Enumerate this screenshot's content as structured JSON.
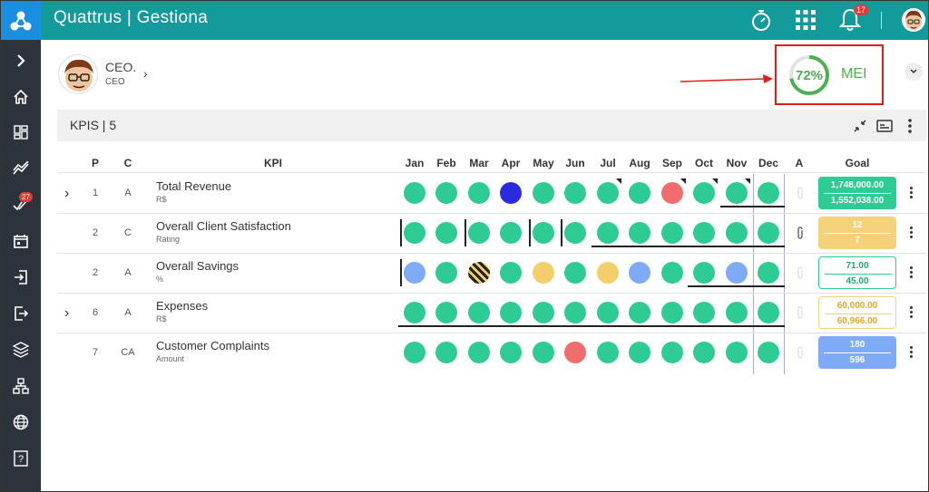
{
  "app": {
    "title": "Quattrus | Gestiona",
    "notifications": "17"
  },
  "sidebar": {
    "tasks_badge": "27"
  },
  "profile": {
    "name": "CEO.",
    "role": "CEO"
  },
  "mei": {
    "percent_text": "72%",
    "percent": 72,
    "label": "MEI"
  },
  "kpis": {
    "title": "KPIS | 5"
  },
  "table": {
    "headers": {
      "p": "P",
      "c": "C",
      "kpi": "KPI",
      "a": "A",
      "goal": "Goal"
    },
    "months": [
      "Jan",
      "Feb",
      "Mar",
      "Apr",
      "May",
      "Jun",
      "Jul",
      "Aug",
      "Sep",
      "Oct",
      "Nov",
      "Dec"
    ],
    "rows": [
      {
        "p": "1",
        "c": "A",
        "name": "Total Revenue",
        "unit": "R$",
        "goal_top": "1,748,000.00",
        "goal_bottom": "1,552,038.00"
      },
      {
        "p": "2",
        "c": "C",
        "name": "Overall Client Satisfaction",
        "unit": "Rating",
        "goal_top": "12",
        "goal_bottom": "7"
      },
      {
        "p": "2",
        "c": "A",
        "name": "Overall Savings",
        "unit": "%",
        "goal_top": "71.00",
        "goal_bottom": "45.00"
      },
      {
        "p": "6",
        "c": "A",
        "name": "Expenses",
        "unit": "R$",
        "goal_top": "60,000.00",
        "goal_bottom": "60,966.00"
      },
      {
        "p": "7",
        "c": "CA",
        "name": "Customer Complaints",
        "unit": "Amount",
        "goal_top": "180",
        "goal_bottom": "596"
      }
    ]
  },
  "colors": {
    "teal": "#139a9a",
    "green": "#2ecc94",
    "blue_dark": "#2a2ae0",
    "red": "#f16d6d",
    "yellow": "#f2cf6b",
    "blue_light": "#7faaf5",
    "goal_green": "#2ecc94",
    "goal_yellow": "#f5d27a",
    "goal_blue": "#7faaf5"
  }
}
